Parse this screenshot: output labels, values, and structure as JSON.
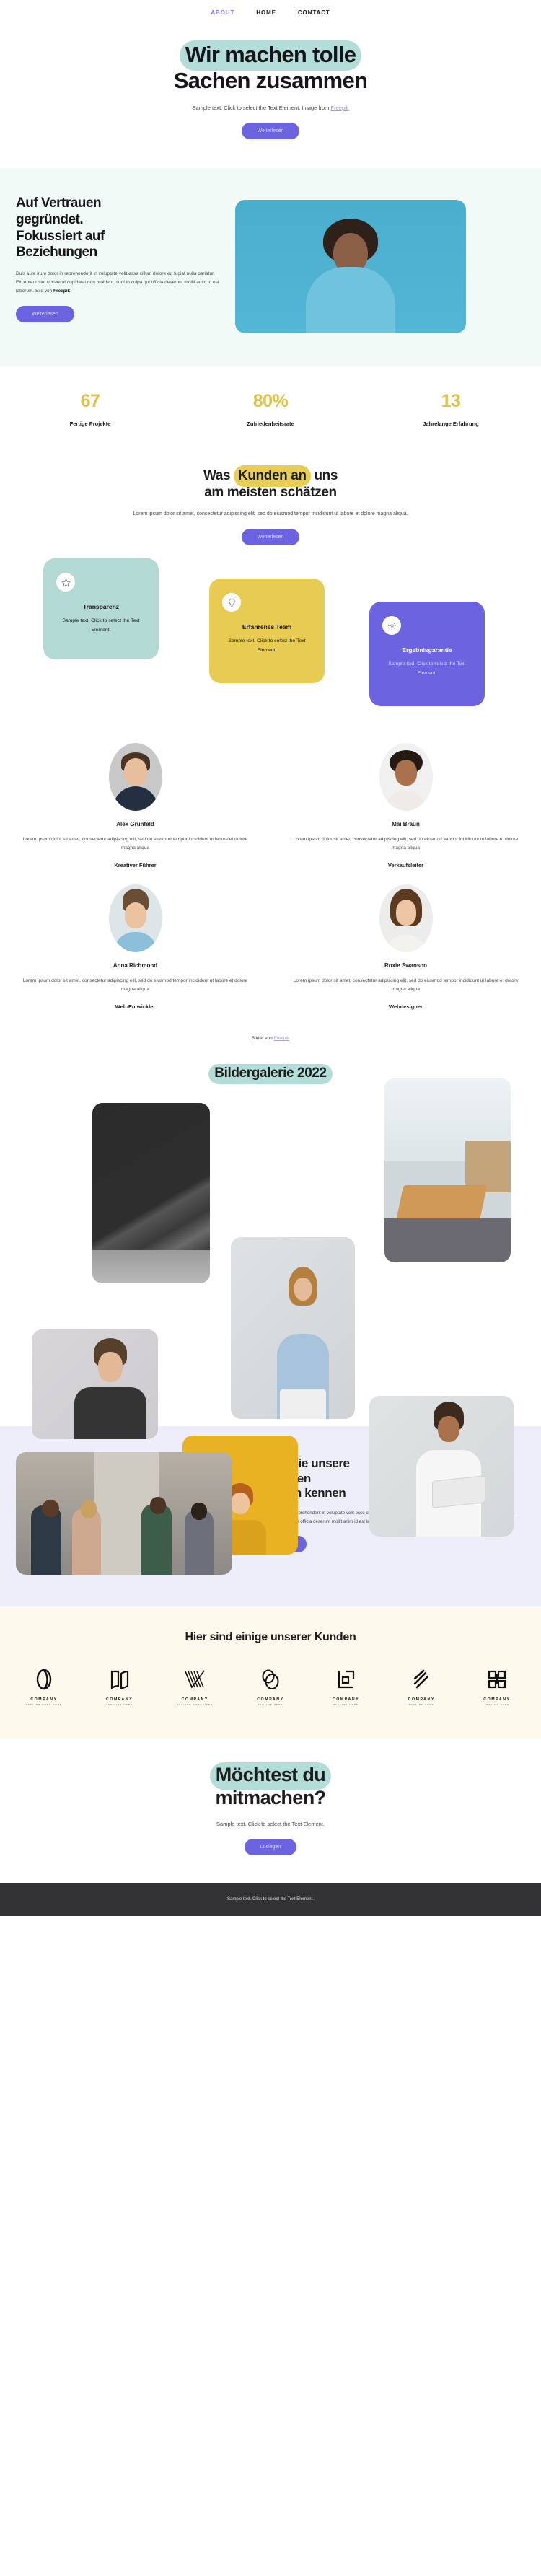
{
  "nav": {
    "items": [
      {
        "label": "ABOUT",
        "active": true
      },
      {
        "label": "HOME",
        "active": false
      },
      {
        "label": "CONTACT",
        "active": false
      }
    ]
  },
  "hero": {
    "title_line1": "Wir machen tolle",
    "title_line2": "Sachen zusammen",
    "subtitle": "Sample text. Click to select the Text Element. Image from ",
    "subtitle_link": "Freepik",
    "button": "Weiterlesen"
  },
  "trust": {
    "title_line1": "Auf Vertrauen",
    "title_line2": "gegründet.",
    "title_line3": "Fokussiert auf",
    "title_line4": "Beziehungen",
    "body": "Duis aute irure dolor in reprehenderit in voluptate velit esse cillum dolore eu fugiat nulla pariatur. Excepteur sint occaecat cupidatat non proident, sunt in culpa qui officia deserunt mollit anim id est laborum. Bild von ",
    "body_bold": "Freepik",
    "button": "Weiterlesen"
  },
  "stats": [
    {
      "number": "67",
      "label": "Fertige Projekte"
    },
    {
      "number": "80%",
      "label": "Zufriedenheitsrate"
    },
    {
      "number": "13",
      "label": "Jahrelange Erfahrung"
    }
  ],
  "values": {
    "title_part1": "Was ",
    "title_highlight": "Kunden an",
    "title_part2": " uns",
    "title_line2": "am meisten schätzen",
    "subtitle": "Lorem ipsum dolor sit amet, consectetur adipiscing elit, sed do eiusmod tempor incididunt ut labore et dolore magna aliqua.",
    "button": "Weiterlesen",
    "cards": [
      {
        "icon": "star-icon",
        "title": "Transparenz",
        "text": "Sample text. Click to select the Text Element.",
        "color": "#b3d9d4"
      },
      {
        "icon": "lightbulb-icon",
        "title": "Erfahrenes Team",
        "text": "Sample text. Click to select the Text Element.",
        "color": "#e8cb53"
      },
      {
        "icon": "gear-icon",
        "title": "Ergebnisgarantie",
        "text": "Sample text. Click to select the Text Element.",
        "color": "#6b63e0"
      }
    ]
  },
  "team": {
    "bio": "Lorem ipsum dolor sit amet, consectetur adipiscing elit, sed do eiusmod tempor incididunt ut labore et dolore magna aliqua",
    "members": [
      {
        "name": "Alex Grünfeld",
        "role": "Kreativer Führer"
      },
      {
        "name": "Mai Braun",
        "role": "Verkaufsleiter"
      },
      {
        "name": "Anna Richmond",
        "role": "Web-Entwickler"
      },
      {
        "name": "Roxie Swanson",
        "role": "Webdesigner"
      }
    ],
    "credit": "Bilder von ",
    "credit_link": "Freepik"
  },
  "gallery": {
    "title": "Bildergalerie 2022"
  },
  "creatives": {
    "title_line1": "Lernen Sie unsere",
    "title_line2": "talentierten",
    "title_line3": "Kreativen kennen",
    "body": "Duis aute irure dolor in reprehenderit in voluptate velit esse cillum dolore eu fugiat nulla pariatur. Excepteur sint occaecat cupidatat non proident, sunt in culpa qui officia deserunt mollit anim id est laborum. Bild von ",
    "body_bold": "Freepik",
    "button": "Weiterlesen"
  },
  "clients": {
    "title": "Hier sind einige unserer Kunden",
    "logos": [
      {
        "name": "COMPANY",
        "tagline": "TAGLINE GOES HERE",
        "mark": "oval-ring-logo"
      },
      {
        "name": "COMPANY",
        "tagline": "TAG LINE HERE",
        "mark": "open-book-logo"
      },
      {
        "name": "COMPANY",
        "tagline": "TAGLINE GOES HERE",
        "mark": "checkmark-lines-logo"
      },
      {
        "name": "COMPANY",
        "tagline": "TAGLINE HERE",
        "mark": "double-oval-logo"
      },
      {
        "name": "COMPANY",
        "tagline": "TAGLINE HERE",
        "mark": "square-bracket-logo"
      },
      {
        "name": "COMPANY",
        "tagline": "TAGLINE HERE",
        "mark": "diagonal-stripes-logo"
      },
      {
        "name": "COMPANY",
        "tagline": "TAGLINE HERE",
        "mark": "block-grid-logo"
      }
    ]
  },
  "cta": {
    "title_line1": "Möchtest du",
    "title_line2": "mitmachen?",
    "subtitle": "Sample text. Click to select the Text Element.",
    "button": "Loslegen"
  },
  "footer": {
    "text": "Sample text. Click to select the Text Element."
  },
  "colors": {
    "accent_purple": "#6b63e0",
    "teal_highlight": "#b3ddd8",
    "yellow_highlight": "#e8cd57",
    "stat_gold": "#e0c14c",
    "lavender_bg": "#eeeefb",
    "cream_bg": "#fdf9ec",
    "mint_bg": "#f2faf8",
    "footer_bg": "#323234"
  }
}
